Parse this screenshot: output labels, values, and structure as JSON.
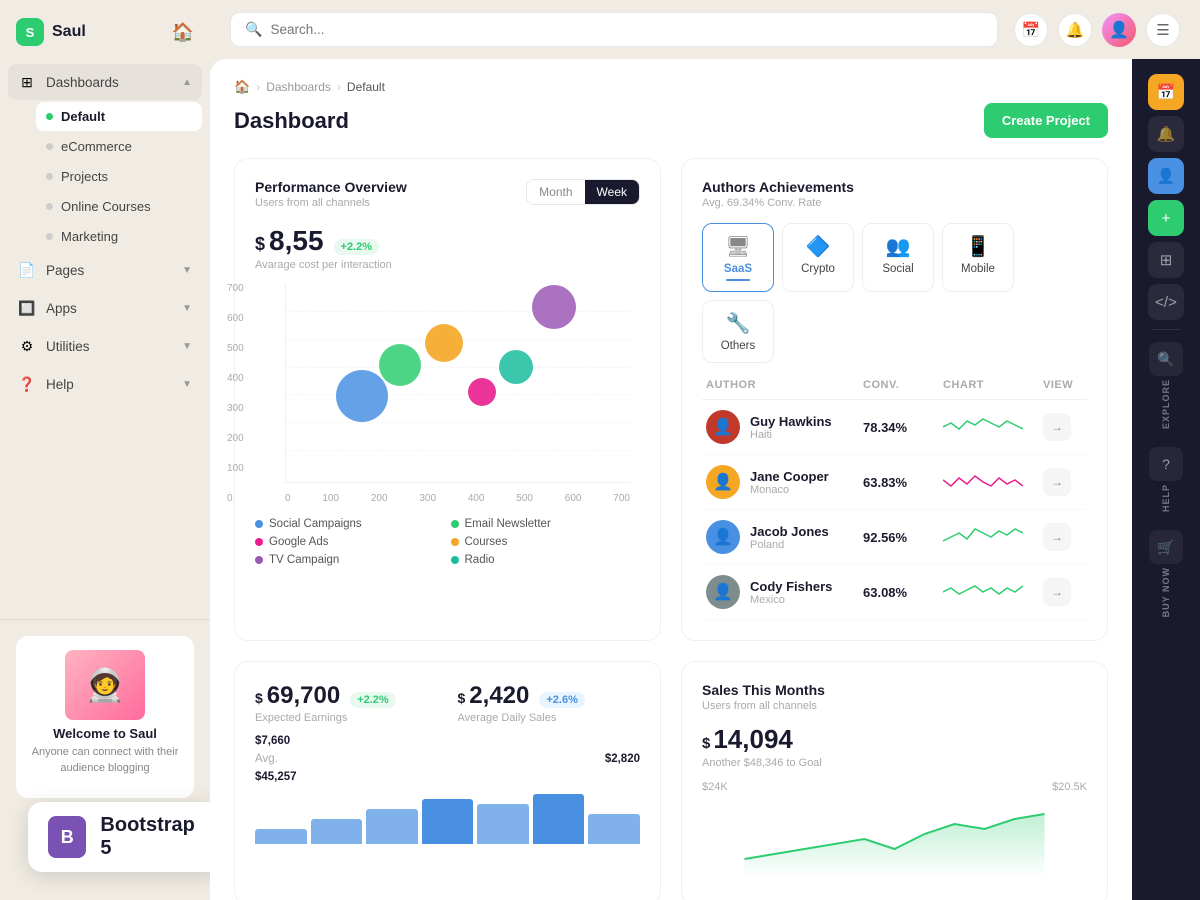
{
  "app": {
    "name": "Saul",
    "logo_letter": "S"
  },
  "sidebar": {
    "nav": [
      {
        "id": "dashboards",
        "label": "Dashboards",
        "icon": "⊞",
        "hasArrow": true,
        "expanded": true,
        "children": [
          {
            "id": "default",
            "label": "Default",
            "active": true
          },
          {
            "id": "ecommerce",
            "label": "eCommerce"
          },
          {
            "id": "projects",
            "label": "Projects"
          },
          {
            "id": "online-courses",
            "label": "Online Courses"
          },
          {
            "id": "marketing",
            "label": "Marketing"
          }
        ]
      },
      {
        "id": "pages",
        "label": "Pages",
        "icon": "📄",
        "hasArrow": true
      },
      {
        "id": "apps",
        "label": "Apps",
        "icon": "🔲",
        "hasArrow": true
      },
      {
        "id": "utilities",
        "label": "Utilities",
        "icon": "⚙",
        "hasArrow": true
      },
      {
        "id": "help",
        "label": "Help",
        "icon": "❓",
        "hasArrow": true
      }
    ],
    "welcome": {
      "title": "Welcome to Saul",
      "subtitle": "Anyone can connect with their audience blogging"
    }
  },
  "topbar": {
    "search_placeholder": "Search...",
    "search_hint": "Search _"
  },
  "breadcrumb": {
    "items": [
      "Dashboards",
      "Default"
    ]
  },
  "page": {
    "title": "Dashboard",
    "create_btn": "Create Project"
  },
  "performance": {
    "title": "Performance Overview",
    "subtitle": "Users from all channels",
    "period_month": "Month",
    "period_week": "Week",
    "metric_value": "8,55",
    "metric_currency": "$",
    "metric_badge": "+2.2%",
    "metric_label": "Avarage cost per interaction",
    "y_labels": [
      "700",
      "600",
      "500",
      "400",
      "300",
      "200",
      "100",
      "0"
    ],
    "x_labels": [
      "0",
      "100",
      "200",
      "300",
      "400",
      "500",
      "600",
      "700"
    ],
    "bubbles": [
      {
        "x": 22,
        "y": 57,
        "size": 52,
        "color": "#4a90e2"
      },
      {
        "x": 33,
        "y": 41,
        "size": 42,
        "color": "#2ecc71"
      },
      {
        "x": 46,
        "y": 27,
        "size": 38,
        "color": "#f5a623"
      },
      {
        "x": 57,
        "y": 55,
        "size": 28,
        "color": "#e91e8c"
      },
      {
        "x": 68,
        "y": 42,
        "size": 34,
        "color": "#1abc9c"
      },
      {
        "x": 77,
        "y": 10,
        "size": 44,
        "color": "#9b59b6"
      }
    ],
    "legend": [
      {
        "color": "#4a90e2",
        "label": "Social Campaigns"
      },
      {
        "color": "#2ecc71",
        "label": "Email Newsletter"
      },
      {
        "color": "#e91e8c",
        "label": "Google Ads"
      },
      {
        "color": "#f5a623",
        "label": "Courses"
      },
      {
        "color": "#9b59b6",
        "label": "TV Campaign"
      },
      {
        "color": "#1abc9c",
        "label": "Radio"
      }
    ]
  },
  "authors": {
    "title": "Authors Achievements",
    "subtitle": "Avg. 69.34% Conv. Rate",
    "categories": [
      {
        "id": "saas",
        "label": "SaaS",
        "icon": "🖥",
        "active": true
      },
      {
        "id": "crypto",
        "label": "Crypto",
        "icon": "🔷"
      },
      {
        "id": "social",
        "label": "Social",
        "icon": "👥"
      },
      {
        "id": "mobile",
        "label": "Mobile",
        "icon": "📱"
      },
      {
        "id": "others",
        "label": "Others",
        "icon": "🔧"
      }
    ],
    "table_headers": {
      "author": "AUTHOR",
      "conv": "CONV.",
      "chart": "CHART",
      "view": "VIEW"
    },
    "rows": [
      {
        "name": "Guy Hawkins",
        "country": "Haiti",
        "conv": "78.34%",
        "sparkline_color": "#2ecc71",
        "avatar_bg": "#c0392b"
      },
      {
        "name": "Jane Cooper",
        "country": "Monaco",
        "conv": "63.83%",
        "sparkline_color": "#e91e8c",
        "avatar_bg": "#f5a623"
      },
      {
        "name": "Jacob Jones",
        "country": "Poland",
        "conv": "92.56%",
        "sparkline_color": "#2ecc71",
        "avatar_bg": "#4a90e2"
      },
      {
        "name": "Cody Fishers",
        "country": "Mexico",
        "conv": "63.08%",
        "sparkline_color": "#2ecc71",
        "avatar_bg": "#7f8c8d"
      }
    ]
  },
  "earnings": {
    "value1": "69,700",
    "currency1": "$",
    "badge1": "+2.2%",
    "label1": "Expected Earnings",
    "value2": "2,420",
    "currency2": "$",
    "badge2": "+2.6%",
    "label2": "Average Daily Sales",
    "num_rows": [
      {
        "key": "",
        "val": "$7,660"
      },
      {
        "key": "Avg.",
        "val": "$2,820"
      },
      {
        "key": "",
        "val": "$45,257"
      }
    ]
  },
  "sales": {
    "title": "Sales This Months",
    "subtitle": "Users from all channels",
    "amount": "14,094",
    "currency": "$",
    "note": "Another $48,346 to Goal",
    "y1": "$24K",
    "y2": "$20.5K"
  },
  "right_sidebar": {
    "explore_label": "Explore",
    "help_label": "Help",
    "buynow_label": "Buy now"
  }
}
